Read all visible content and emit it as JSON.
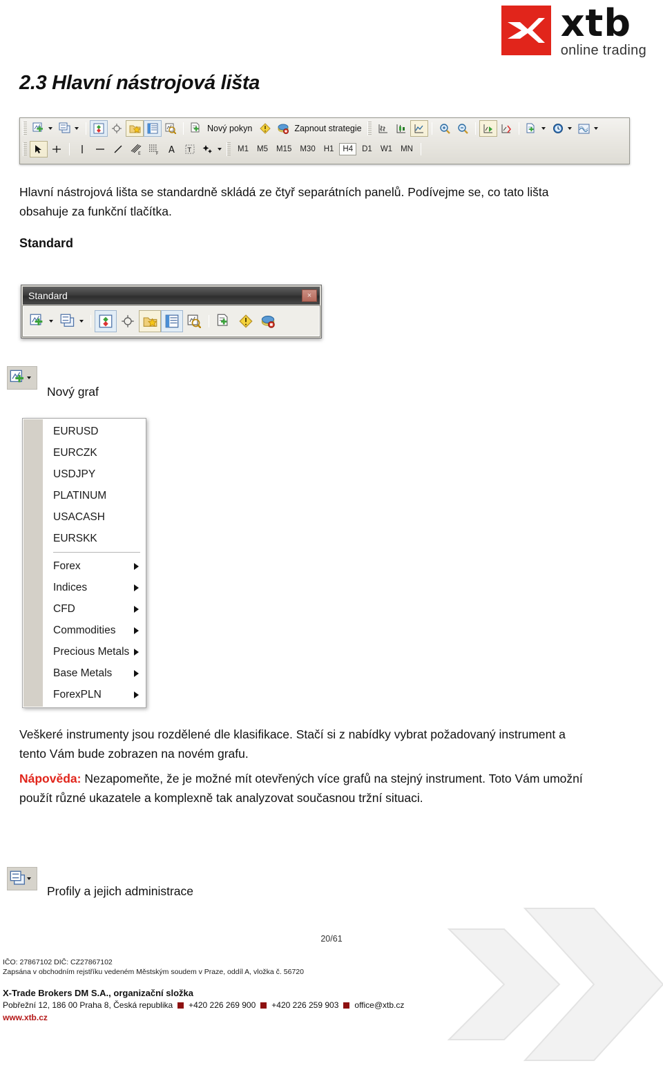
{
  "logo": {
    "brand": "xtb",
    "tagline": "online trading",
    "brand_color": "#e1251b",
    "mark_icon": "xtb-x-mark-icon"
  },
  "section": {
    "heading": "2.3 Hlavní nástrojová lišta",
    "intro": "Hlavní nástrojová lišta se standardně skládá ze čtyř separátních panelů. Podívejme se, co tato lišta obsahuje za funkční tlačítka.",
    "standard_heading": "Standard"
  },
  "main_toolbar": {
    "row1": {
      "new_chart_icon": "new-chart-icon",
      "profiles_icon": "profiles-icon",
      "market_watch_icon": "market-watch-icon",
      "navigator_icon": "navigator-icon",
      "favourites_icon": "favourites-folder-icon",
      "terminal_icon": "terminal-icon",
      "data_window_icon": "data-window-icon",
      "new_order_label": "Nový pokyn",
      "new_order_icon": "new-order-icon",
      "alert_icon": "alert-warning-icon",
      "strategy_label": "Zapnout strategie",
      "strategy_icon": "strategy-icon",
      "bar_chart_icon": "bar-chart-icon",
      "candle_chart_icon": "candlestick-chart-icon",
      "line_chart_icon": "line-chart-icon",
      "zoom_in_icon": "zoom-in-icon",
      "zoom_out_icon": "zoom-out-icon",
      "auto_scroll_icon": "auto-scroll-icon",
      "chart_shift_icon": "chart-shift-icon",
      "templates_icon": "templates-icon",
      "period_icon": "period-clock-icon",
      "indicators_icon": "indicators-icon"
    },
    "row2": {
      "cursor_icon": "cursor-arrow-icon",
      "crosshair_icon": "crosshair-icon",
      "vertical_line_icon": "vertical-line-icon",
      "horizontal_line_icon": "horizontal-line-icon",
      "trendline_icon": "trendline-icon",
      "fibo_e_icon": "fibonacci-expansion-icon",
      "fibo_f_icon": "fibonacci-retracement-icon",
      "text_icon": "text-tool-icon",
      "label_icon": "text-label-icon",
      "shapes_icon": "shapes-icon",
      "timeframes": [
        "M1",
        "M5",
        "M15",
        "M30",
        "H1",
        "H4",
        "D1",
        "W1",
        "MN"
      ],
      "active_timeframe": "H4"
    }
  },
  "standard_panel": {
    "title": "Standard",
    "close_label": "×",
    "close_icon": "close-icon",
    "buttons": [
      "new-chart-icon",
      "profiles-icon",
      "market-watch-icon",
      "navigator-icon",
      "favourites-folder-icon",
      "terminal-icon",
      "data-window-icon",
      "new-order-icon",
      "alert-warning-icon",
      "strategy-icon"
    ]
  },
  "new_chart": {
    "icon": "new-chart-icon",
    "caption": "Nový graf"
  },
  "instrument_menu": {
    "symbols": [
      "EURUSD",
      "EURCZK",
      "USDJPY",
      "PLATINUM",
      "USACASH",
      "EURSKK"
    ],
    "categories": [
      "Forex",
      "Indices",
      "CFD",
      "Commodities",
      "Precious Metals",
      "Base Metals",
      "ForexPLN"
    ],
    "submenu_arrow_icon": "submenu-arrow-icon"
  },
  "body": {
    "paragraph2": "Veškeré instrumenty jsou rozdělené dle klasifikace. Stačí si z nabídky vybrat požadovaný instrument a tento Vám bude zobrazen na novém grafu.",
    "hint_label": "Nápověda:",
    "hint_text": " Nezapomeňte, že je možné mít otevřených více grafů na stejný instrument. Toto Vám umožní použít různé ukazatele a komplexně tak analyzovat současnou tržní situaci.",
    "hint_color": "#e1251b"
  },
  "profiles": {
    "icon": "profiles-icon",
    "caption": "Profily a jejich administrace"
  },
  "footer": {
    "page": "20/61",
    "ico_line": "IČO: 27867102 DIČ: CZ27867102",
    "register_line": "Zapsána v obchodním rejstříku vedeném Městským soudem v Praze, oddíl A, vložka č. 56720",
    "company": "X-Trade Brokers DM S.A., organizační složka",
    "address": "Pobřežní 12, 186 00 Praha 8, Česká republika",
    "phone1": "+420 226 269 900",
    "phone2": "+420 226 259 903",
    "email": "office@xtb.cz",
    "web": "www.xtb.cz"
  }
}
